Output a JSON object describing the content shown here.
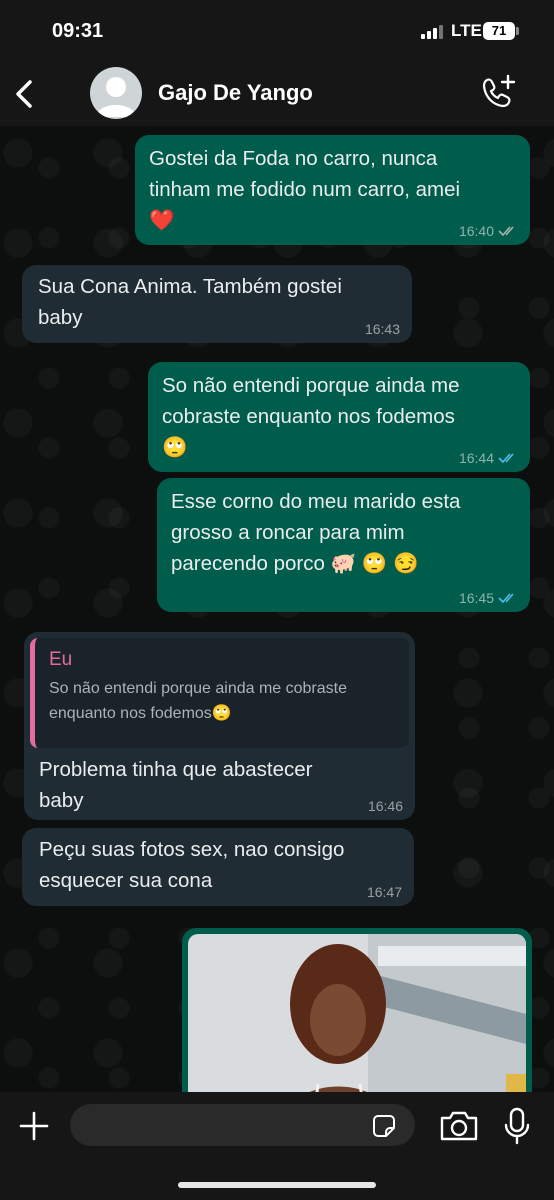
{
  "status_bar": {
    "time": "09:31",
    "network": "LTE",
    "battery": "71"
  },
  "header": {
    "contact_name": "Gajo De Yango"
  },
  "messages": [
    {
      "direction": "out",
      "text": "Gostei da Foda no carro, nunca\ntinham me fodido num carro, amei\n❤️",
      "time": "16:40",
      "status": "delivered"
    },
    {
      "direction": "in",
      "text": "Sua Cona Anima. Também gostei\nbaby",
      "time": "16:43"
    },
    {
      "direction": "out",
      "text": "So não entendi porque ainda me\ncobraste enquanto nos fodemos\n🙄",
      "time": "16:44",
      "status": "read"
    },
    {
      "direction": "out",
      "text": "Esse corno do meu marido esta\ngrosso a roncar para mim\nparecendo porco 🐖  🙄 😏",
      "time": "16:45",
      "status": "read"
    },
    {
      "direction": "in",
      "reply_to": {
        "author": "Eu",
        "text": "So não entendi porque ainda me cobraste\nenquanto nos fodemos🙄"
      },
      "text": "Problema tinha que abastecer\nbaby",
      "time": "16:46"
    },
    {
      "direction": "in",
      "text": "Peçu suas fotos sex, nao consigo\nesquecer sua cona",
      "time": "16:47"
    }
  ],
  "photo_message": {
    "direction": "out",
    "icon": "photo-thumbnail"
  },
  "composer": {
    "placeholder": ""
  },
  "colors": {
    "outgoing_bubble": "#005c4b",
    "incoming_bubble": "#202c33",
    "read_ticks": "#53bdeb",
    "quote_accent": "#e26b9f"
  }
}
